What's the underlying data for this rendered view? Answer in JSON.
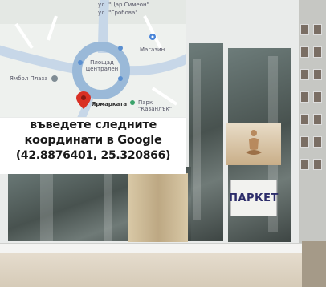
{
  "map": {
    "labels": {
      "street_1": "ул. \"Цар Симеон\"",
      "street_2": "ул. \"Гробова\"",
      "square": "Площад Централен",
      "place_left": "Ямбол Плаза",
      "place_right": "Магазин",
      "park": "Парк \"Казанлък\""
    },
    "pin_label": "Ярмарката",
    "marker_color": "#d93025",
    "road_color": "#9ab9d8",
    "water_color": "#6ea6d8"
  },
  "caption": {
    "line1": "въведете следните",
    "line2": "координати в Google",
    "coordinates": "(42.8876401, 25.320866)"
  },
  "window_sign": {
    "text": "ПАРКЕТ"
  }
}
